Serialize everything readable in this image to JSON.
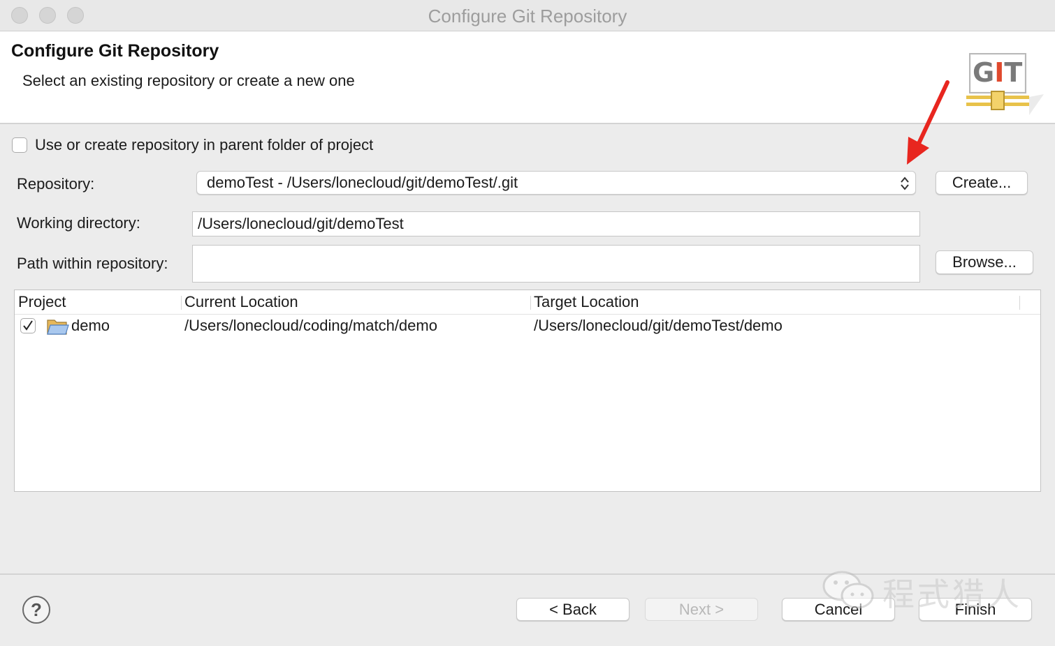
{
  "window": {
    "title": "Configure Git Repository"
  },
  "header": {
    "title": "Configure Git Repository",
    "description": "Select an existing repository or create a new one",
    "logo_text": "GIT"
  },
  "form": {
    "parent_folder_checkbox": {
      "label": "Use or create repository in parent folder of project",
      "checked": false
    },
    "repository": {
      "label": "Repository:",
      "value": "demoTest - /Users/lonecloud/git/demoTest/.git"
    },
    "create_button": "Create...",
    "working_directory": {
      "label": "Working directory:",
      "value": "/Users/lonecloud/git/demoTest"
    },
    "path_within_repository": {
      "label": "Path within repository:",
      "value": ""
    },
    "browse_button": "Browse..."
  },
  "table": {
    "columns": [
      "Project",
      "Current Location",
      "Target Location"
    ],
    "rows": [
      {
        "checked": true,
        "project": "demo",
        "current_location": "/Users/lonecloud/coding/match/demo",
        "target_location": "/Users/lonecloud/git/demoTest/demo"
      }
    ]
  },
  "footer": {
    "help_icon": "?",
    "back_button": "< Back",
    "next_button": "Next >",
    "cancel_button": "Cancel",
    "finish_button": "Finish"
  },
  "watermark": {
    "text": "程式猎人"
  },
  "colors": {
    "arrow": "#e8261f"
  }
}
